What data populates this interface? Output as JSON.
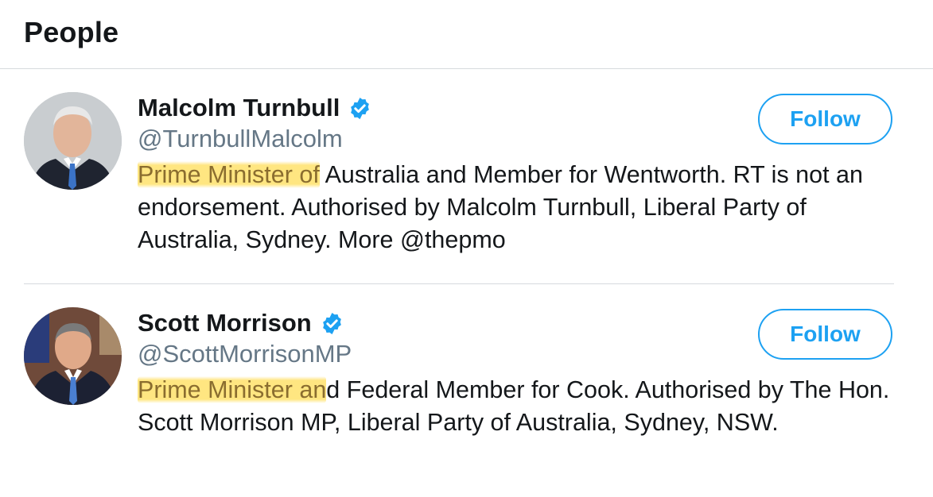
{
  "header": {
    "title": "People"
  },
  "people": [
    {
      "name": "Malcolm Turnbull",
      "verified": true,
      "handle": "@TurnbullMalcolm",
      "bio_highlight": "Prime Minister of",
      "bio_rest": " Australia and Member for Wentworth. RT is not an endorsement. Authorised by Malcolm Turnbull, Liberal Party of Australia, Sydney. More @thepmo",
      "follow_label": "Follow"
    },
    {
      "name": "Scott Morrison",
      "verified": true,
      "handle": "@ScottMorrisonMP",
      "bio_highlight": "Prime Minister an",
      "bio_rest": "d Federal Member for Cook. Authorised by The Hon. Scott Morrison MP, Liberal Party of Australia, Sydney, NSW.",
      "follow_label": "Follow"
    }
  ],
  "colors": {
    "accent": "#1da1f2",
    "highlight": "#ffdd57",
    "handle": "#657786",
    "divider": "#d6dade"
  },
  "icons": {
    "verified": "verified-badge-icon"
  }
}
